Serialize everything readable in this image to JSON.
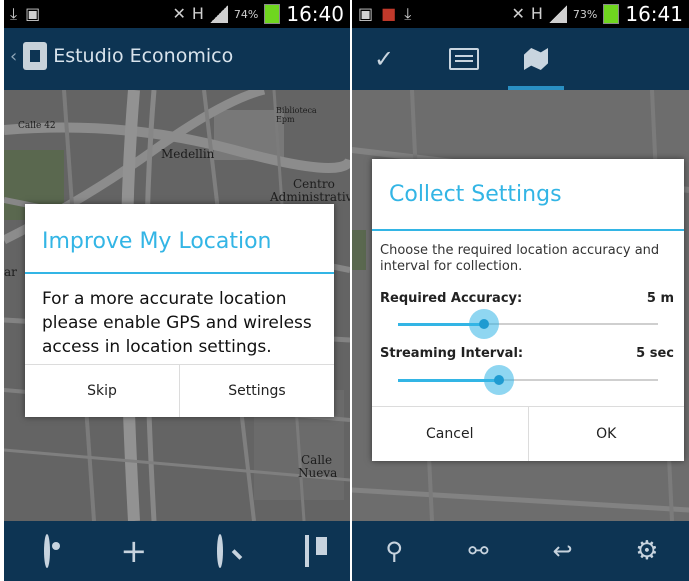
{
  "left_screen": {
    "status_bar": {
      "time": "16:40",
      "battery_pct": "74%"
    },
    "action_bar": {
      "title": "Estudio Economico"
    },
    "map": {
      "labels": [
        "Calle 42",
        "Medellin",
        "Centro",
        "Administrativo",
        "Calle",
        "Nueva",
        "Biblioteca Epm",
        "ar"
      ]
    },
    "dialog": {
      "title": "Improve My Location",
      "message": "For a more accurate location please enable GPS and wireless access in location settings.",
      "buttons": {
        "skip": "Skip",
        "settings": "Settings"
      }
    },
    "bottom_bar": {
      "icons": [
        "locate-icon",
        "add-icon",
        "search-icon",
        "layers-icon"
      ]
    }
  },
  "right_screen": {
    "status_bar": {
      "time": "16:41",
      "battery_pct": "73%"
    },
    "action_bar": {
      "tabs": [
        "check-icon",
        "form-icon",
        "map-icon"
      ],
      "active_tab": "map-icon"
    },
    "dialog": {
      "title": "Collect Settings",
      "description": "Choose the required location accuracy and interval for collection.",
      "required_accuracy": {
        "label": "Required Accuracy:",
        "value": "5 m",
        "slider_level": 0.33
      },
      "streaming_interval": {
        "label": "Streaming Interval:",
        "value": "5 sec",
        "slider_level": 0.39
      },
      "buttons": {
        "cancel": "Cancel",
        "ok": "OK"
      }
    },
    "bottom_bar": {
      "icons": [
        "collect-icon",
        "attachment-icon",
        "undo-icon",
        "gear-icon"
      ]
    }
  },
  "colors": {
    "accent": "#33b5e5",
    "action_bar": "#0d3453",
    "battery": "#6fd61f"
  }
}
